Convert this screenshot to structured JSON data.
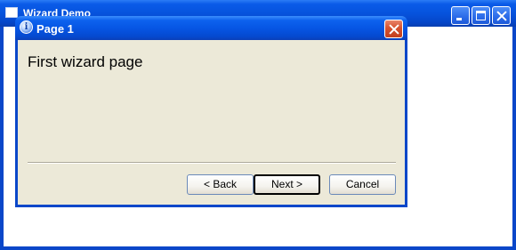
{
  "main_window": {
    "title": "Wizard Demo"
  },
  "dialog": {
    "title": "Page 1",
    "icon": "info-icon",
    "page_heading": "First wizard page",
    "buttons": {
      "back": "< Back",
      "next": "Next >",
      "cancel": "Cancel"
    }
  },
  "colors": {
    "titlebar_blue": "#0653dd",
    "dialog_face": "#ece9d8",
    "close_red": "#d6522f"
  }
}
